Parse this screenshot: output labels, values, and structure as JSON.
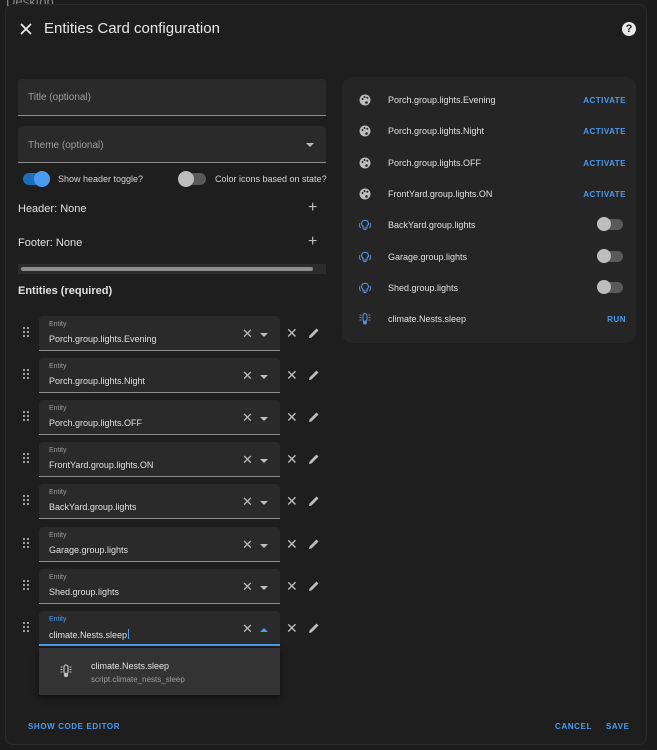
{
  "backdrop": {
    "title": "Desktop"
  },
  "dialog": {
    "title": "Entities Card configuration",
    "help_glyph": "?"
  },
  "form": {
    "title_placeholder": "Title (optional)",
    "theme_placeholder": "Theme (optional)",
    "show_header_toggle": {
      "label": "Show header toggle?",
      "on": true
    },
    "color_icons": {
      "label": "Color icons based on state?",
      "on": false
    },
    "header_row": "Header: None",
    "footer_row": "Footer: None",
    "entities_title": "Entities (required)"
  },
  "entities": [
    {
      "label": "Entity",
      "value": "Porch.group.lights.Evening"
    },
    {
      "label": "Entity",
      "value": "Porch.group.lights.Night"
    },
    {
      "label": "Entity",
      "value": "Porch.group.lights.OFF"
    },
    {
      "label": "Entity",
      "value": "FrontYard.group.lights.ON"
    },
    {
      "label": "Entity",
      "value": "BackYard.group.lights"
    },
    {
      "label": "Entity",
      "value": "Garage.group.lights"
    },
    {
      "label": "Entity",
      "value": "Shed.group.lights"
    },
    {
      "label": "Entity",
      "value": "climate.Nests.sleep"
    }
  ],
  "dropdown": {
    "name": "climate.Nests.sleep",
    "id": "script.climate_nests_sleep"
  },
  "preview": [
    {
      "name": "Porch.group.lights.Evening",
      "icon": "palette-icon",
      "action": "ACTIVATE"
    },
    {
      "name": "Porch.group.lights.Night",
      "icon": "palette-icon",
      "action": "ACTIVATE"
    },
    {
      "name": "Porch.group.lights.OFF",
      "icon": "palette-icon",
      "action": "ACTIVATE"
    },
    {
      "name": "FrontYard.group.lights.ON",
      "icon": "palette-icon",
      "action": "ACTIVATE"
    },
    {
      "name": "BackYard.group.lights",
      "icon": "lightbulb-group-icon",
      "toggle": false
    },
    {
      "name": "Garage.group.lights",
      "icon": "lightbulb-group-icon",
      "toggle": false
    },
    {
      "name": "Shed.group.lights",
      "icon": "lightbulb-group-icon",
      "toggle": false
    },
    {
      "name": "climate.Nests.sleep",
      "icon": "script-icon",
      "action": "RUN"
    }
  ],
  "footer": {
    "code_editor": "SHOW CODE EDITOR",
    "cancel": "CANCEL",
    "save": "SAVE"
  },
  "colors": {
    "accent": "#4a9cf0",
    "dialog_bg": "#1e1e1e",
    "field_bg": "#2a2a2a",
    "preview_bg": "#252525"
  }
}
